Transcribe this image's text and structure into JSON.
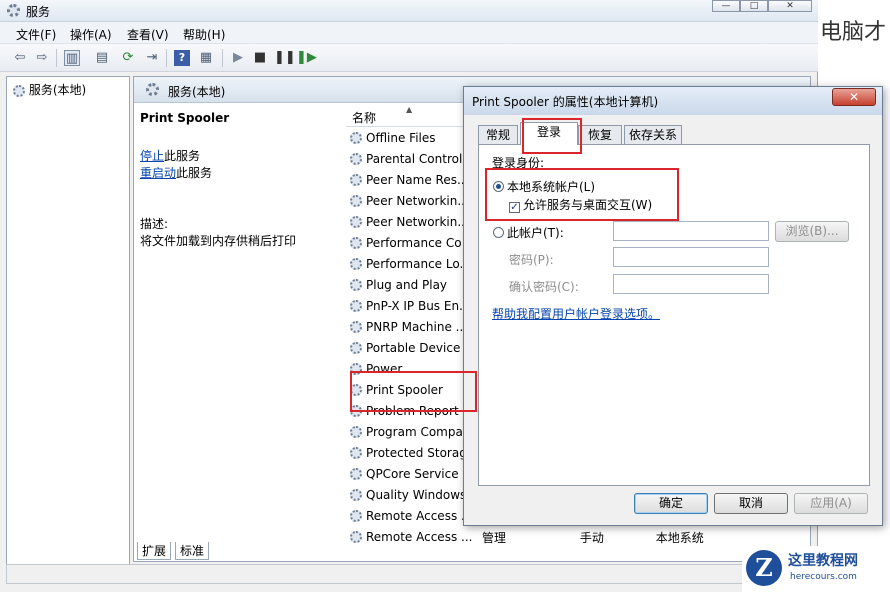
{
  "window": {
    "title": "服务",
    "controls": [
      "—",
      "□",
      "✕"
    ]
  },
  "menu": [
    "文件(F)",
    "操作(A)",
    "查看(V)",
    "帮助(H)"
  ],
  "left_tree": {
    "item": "服务(本地)"
  },
  "right_header": "服务(本地)",
  "detail": {
    "service_name": "Print Spooler",
    "stop_link": "停止",
    "stop_suffix": "此服务",
    "restart_link": "重启动",
    "restart_suffix": "此服务",
    "desc_label": "描述:",
    "desc_text": "将文件加载到内存供稍后打印"
  },
  "list": {
    "column": "名称",
    "sort_icon": "sort-up-icon",
    "services": [
      "Offline Files",
      "Parental Control",
      "Peer Name Res...",
      "Peer Networkin...",
      "Peer Networkin...",
      "Performance Co",
      "Performance Lo...",
      "Plug and Play",
      "PnP-X IP Bus En...",
      "PNRP Machine ...",
      "Portable Device",
      "Power",
      "Print Spooler",
      "Problem Report",
      "Program Compa",
      "Protected Storag",
      "QPCore Service",
      "Quality Windows",
      "Remote Access ...",
      "Remote Access ..."
    ],
    "last_row_extra": [
      "管理",
      "手动",
      "本地系统"
    ]
  },
  "bottom_tabs": [
    "扩展",
    "标准"
  ],
  "dialog": {
    "title": "Print Spooler 的属性(本地计算机)",
    "close": "✕",
    "tabs": [
      "常规",
      "登录",
      "恢复",
      "依存关系"
    ],
    "logon_as": "登录身份:",
    "local_system": "本地系统帐户(L)",
    "allow_desktop": "允许服务与桌面交互(W)",
    "this_account": "此帐户(T):",
    "browse": "浏览(B)...",
    "password": "密码(P):",
    "confirm_password": "确认密码(C):",
    "help_link": "帮助我配置用户帐户登录选项。",
    "ok": "确定",
    "cancel": "取消",
    "apply": "应用(A)"
  },
  "watermark": "电脑才",
  "logo": {
    "letter": "Z",
    "name": "这里教程网",
    "url": "herecours.com"
  },
  "colors": {
    "highlight_red": "#d9262b",
    "link_blue": "#0645ad",
    "logo_blue": "#1f4e9b"
  }
}
